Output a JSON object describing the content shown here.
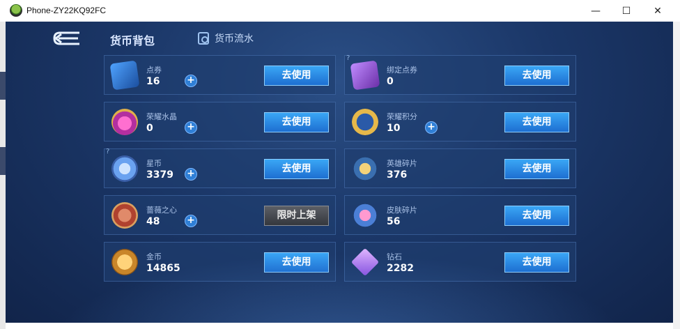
{
  "window": {
    "title": "Phone-ZY22KQ92FC",
    "minimize": "—",
    "maximize": "☐",
    "close": "✕"
  },
  "header": {
    "title": "货币背包",
    "flow_tab": "货币流水"
  },
  "items": [
    {
      "name": "点券",
      "value": "16",
      "plus": "+",
      "button": "去使用",
      "icon": "voucher-icon"
    },
    {
      "name": "绑定点券",
      "value": "0",
      "button": "去使用",
      "icon": "bound-voucher-icon",
      "help": "?"
    },
    {
      "name": "荣耀水晶",
      "value": "0",
      "plus": "+",
      "button": "去使用",
      "icon": "glory-crystal-icon"
    },
    {
      "name": "荣耀积分",
      "value": "10",
      "plus": "+",
      "button": "去使用",
      "icon": "glory-points-icon"
    },
    {
      "name": "星币",
      "value": "3379",
      "plus": "+",
      "button": "去使用",
      "icon": "star-coin-icon",
      "help": "?"
    },
    {
      "name": "英雄碎片",
      "value": "376",
      "button": "去使用",
      "icon": "hero-fragment-icon"
    },
    {
      "name": "蔷薇之心",
      "value": "48",
      "plus": "+",
      "button": "限时上架",
      "icon": "rose-heart-icon"
    },
    {
      "name": "皮肤碎片",
      "value": "56",
      "button": "去使用",
      "icon": "skin-fragment-icon"
    },
    {
      "name": "金币",
      "value": "14865",
      "button": "去使用",
      "icon": "gold-coin-icon"
    },
    {
      "name": "钻石",
      "value": "2282",
      "button": "去使用",
      "icon": "diamond-icon"
    }
  ]
}
